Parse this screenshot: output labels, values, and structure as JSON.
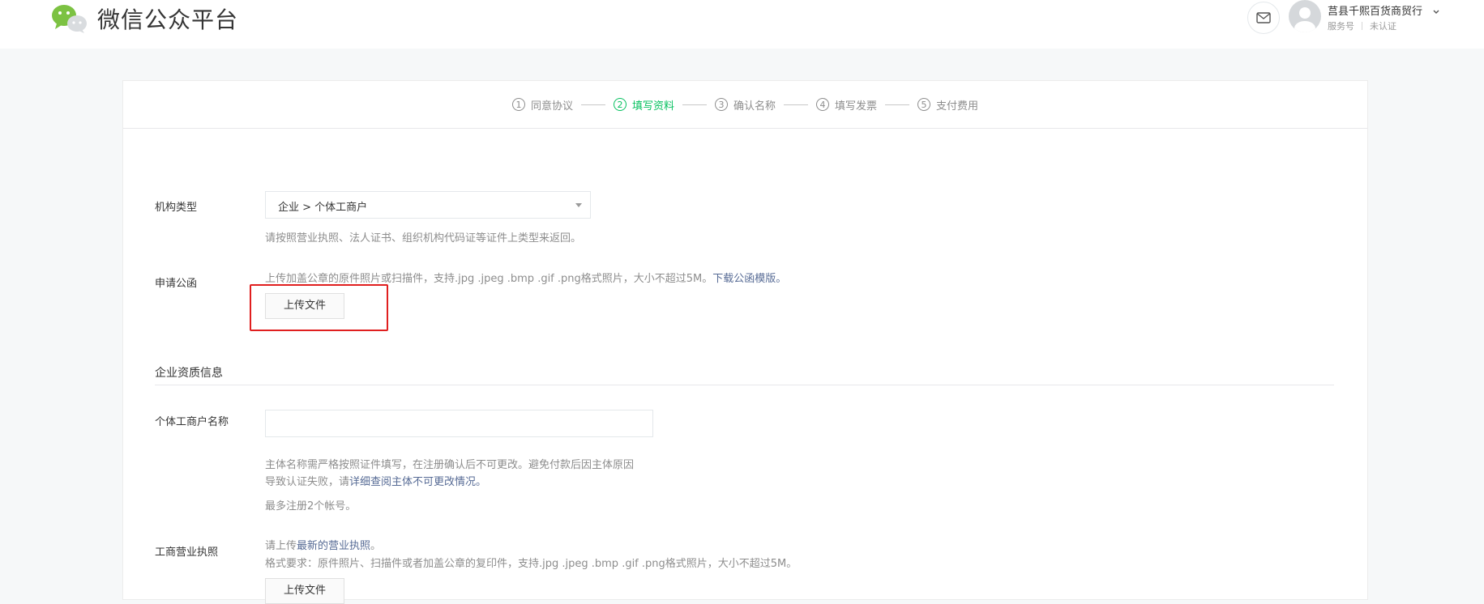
{
  "header": {
    "platform_title": "微信公众平台",
    "account_name": "莒县千熙百货商贸行",
    "account_type": "服务号",
    "verify_status": "未认证"
  },
  "steps": [
    {
      "num": "1",
      "label": "同意协议"
    },
    {
      "num": "2",
      "label": "填写资料"
    },
    {
      "num": "3",
      "label": "确认名称"
    },
    {
      "num": "4",
      "label": "填写发票"
    },
    {
      "num": "5",
      "label": "支付费用"
    }
  ],
  "active_step": 2,
  "form": {
    "org_type": {
      "label": "机构类型",
      "value": "企业 > 个体工商户",
      "hint": "请按照营业执照、法人证书、组织机构代码证等证件上类型来返回。"
    },
    "letter": {
      "label": "申请公函",
      "hint": "上传加盖公章的原件照片或扫描件，支持.jpg .jpeg .bmp .gif .png格式照片，大小不超过5M。",
      "hint_link": "下载公函模版。",
      "upload_button": "上传文件"
    },
    "section_title": "企业资质信息",
    "business_name": {
      "label": "个体工商户名称",
      "value": "",
      "hint_line1": "主体名称需严格按照证件填写，在注册确认后不可更改。避免付款后因主体原因",
      "hint_line2_prefix": "导致认证失败，请",
      "hint_line2_link": "详细查阅主体不可更改情况。",
      "limit_hint": "最多注册2个帐号。"
    },
    "license": {
      "label": "工商营业执照",
      "hint_prefix": "请上传",
      "hint_link": "最新的营业执照",
      "hint_suffix": "。",
      "format_hint": "格式要求：原件照片、扫描件或者加盖公章的复印件，支持.jpg .jpeg .bmp .gif .png格式照片，大小不超过5M。",
      "upload_button": "上传文件"
    }
  },
  "colors": {
    "accent_green": "#07c160",
    "link_blue": "#576b95",
    "highlight_red": "#e01f1f"
  },
  "icons": [
    "wechat-logo-icon",
    "mail-icon",
    "avatar-icon",
    "chevron-down-icon",
    "select-arrow-icon"
  ]
}
